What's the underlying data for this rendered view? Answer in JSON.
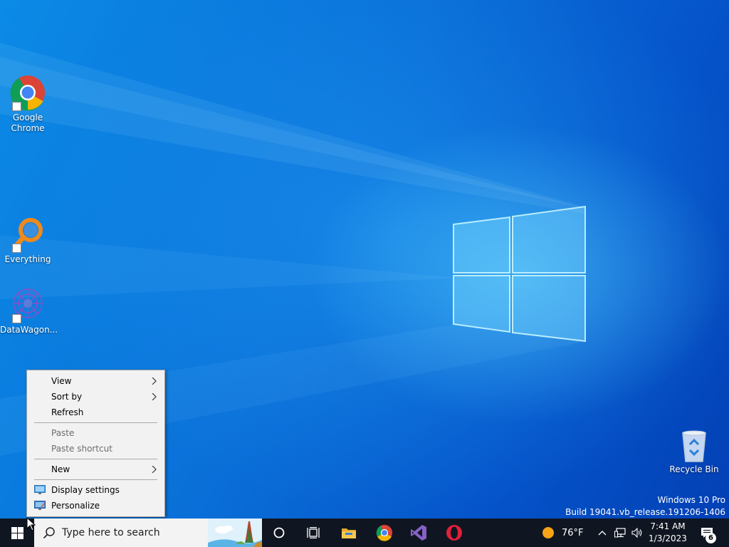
{
  "desktop": {
    "icons": [
      {
        "label_line1": "Google",
        "label_line2": "Chrome",
        "icon": "chrome-icon"
      },
      {
        "label": "Everything",
        "icon": "everything-search-icon"
      },
      {
        "label": "DataWagon...",
        "icon": "datawagon-icon"
      },
      {
        "label": "Recycle Bin",
        "icon": "recycle-bin-icon"
      }
    ],
    "watermark": {
      "edition": "Windows 10 Pro",
      "build": "Build 19041.vb_release.191206-1406"
    }
  },
  "context_menu": {
    "items": [
      {
        "label": "View",
        "submenu": true
      },
      {
        "label": "Sort by",
        "submenu": true
      },
      {
        "label": "Refresh"
      },
      {
        "label": "Paste",
        "disabled": true
      },
      {
        "label": "Paste shortcut",
        "disabled": true
      },
      {
        "label": "New",
        "submenu": true
      },
      {
        "label": "Display settings",
        "icon": "display-icon"
      },
      {
        "label": "Personalize",
        "icon": "personalize-icon"
      }
    ]
  },
  "taskbar": {
    "search_placeholder": "Type here to search",
    "pinned": [
      "cortana-icon",
      "task-view-icon",
      "file-explorer-icon",
      "chrome-icon",
      "visual-studio-icon",
      "opera-icon"
    ],
    "weather": {
      "temp": "76°F"
    },
    "clock": {
      "time": "7:41 AM",
      "date": "1/3/2023"
    },
    "notifications": {
      "count": "6"
    }
  },
  "colors": {
    "taskbar": "#101621",
    "menu_bg": "#f2f2f2",
    "desktop_blue": "#0a6fe0",
    "disabled_text": "#6d6d6d"
  }
}
